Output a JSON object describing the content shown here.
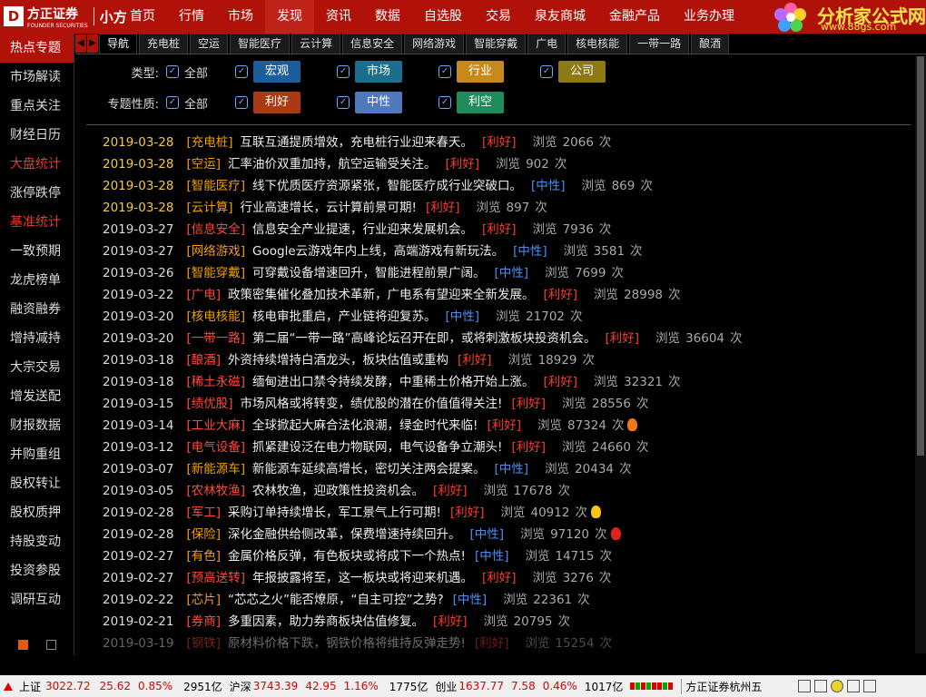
{
  "logo": {
    "brand": "方正证券",
    "brand_sub": "FOUNDER SECURITIES",
    "product": "小方"
  },
  "menu": [
    {
      "label": "首页"
    },
    {
      "label": "行情"
    },
    {
      "label": "市场"
    },
    {
      "label": "发现",
      "active": true
    },
    {
      "label": "资讯"
    },
    {
      "label": "数据"
    },
    {
      "label": "自选股"
    },
    {
      "label": "交易"
    },
    {
      "label": "泉友商城"
    },
    {
      "label": "金融产品"
    },
    {
      "label": "业务办理"
    }
  ],
  "ad": {
    "title": "分析家公式网",
    "url": "www.88gs.com"
  },
  "sidebar": [
    {
      "label": "热点专题",
      "active": true
    },
    {
      "label": "市场解读"
    },
    {
      "label": "重点关注"
    },
    {
      "label": "财经日历"
    },
    {
      "label": "大盘统计",
      "red": true
    },
    {
      "label": "涨停跌停"
    },
    {
      "label": "基准统计",
      "red": true
    },
    {
      "label": "一致预期"
    },
    {
      "label": "龙虎榜单"
    },
    {
      "label": "融资融券"
    },
    {
      "label": "增持减持"
    },
    {
      "label": "大宗交易"
    },
    {
      "label": "增发送配"
    },
    {
      "label": "财报数据"
    },
    {
      "label": "并购重组"
    },
    {
      "label": "股权转让"
    },
    {
      "label": "股权质押"
    },
    {
      "label": "持股变动"
    },
    {
      "label": "投资参股"
    },
    {
      "label": "调研互动"
    }
  ],
  "tabs": [
    {
      "label": "导航",
      "active": true
    },
    {
      "label": "充电桩"
    },
    {
      "label": "空运"
    },
    {
      "label": "智能医疗"
    },
    {
      "label": "云计算"
    },
    {
      "label": "信息安全"
    },
    {
      "label": "网络游戏"
    },
    {
      "label": "智能穿戴"
    },
    {
      "label": "广电"
    },
    {
      "label": "核电核能"
    },
    {
      "label": "一带一路"
    },
    {
      "label": "酿酒"
    }
  ],
  "filters": {
    "type_label": "类型:",
    "nature_label": "专题性质:",
    "all_label": "全部",
    "type_chips": [
      {
        "label": "宏观",
        "color": "#1c5e9c"
      },
      {
        "label": "市场",
        "color": "#1b6f8c"
      },
      {
        "label": "行业",
        "color": "#c8891c"
      },
      {
        "label": "公司",
        "color": "#8e7a14"
      }
    ],
    "nature_chips": [
      {
        "label": "利好",
        "color": "#a83a14"
      },
      {
        "label": "中性",
        "color": "#4f79b8"
      },
      {
        "label": "利空",
        "color": "#1f8c5c"
      }
    ]
  },
  "views_label": "浏览",
  "views_unit": "次",
  "news": [
    {
      "date": "2019-03-28",
      "tag": "[充电桩]",
      "title": "互联互通提质增效，充电桩行业迎来春天。",
      "nature": "[利好]",
      "views": "2066",
      "hl": true
    },
    {
      "date": "2019-03-28",
      "tag": "[空运]",
      "title": "汇率油价双重加持，航空运输受关注。",
      "nature": "[利好]",
      "views": "902",
      "hl": true
    },
    {
      "date": "2019-03-28",
      "tag": "[智能医疗]",
      "title": "线下优质医疗资源紧张，智能医疗成行业突破口。",
      "nature": "[中性]",
      "views": "869",
      "hl": true
    },
    {
      "date": "2019-03-28",
      "tag": "[云计算]",
      "title": "行业高速增长，云计算前景可期!",
      "nature": "[利好]",
      "views": "897",
      "hl": true
    },
    {
      "date": "2019-03-27",
      "tag": "[信息安全]",
      "title": "信息安全产业提速，行业迎来发展机会。",
      "nature": "[利好]",
      "views": "7936"
    },
    {
      "date": "2019-03-27",
      "tag": "[网络游戏]",
      "title": "Google云游戏年内上线，高端游戏有新玩法。",
      "nature": "[中性]",
      "views": "3581"
    },
    {
      "date": "2019-03-26",
      "tag": "[智能穿戴]",
      "title": "可穿戴设备增速回升，智能进程前景广阔。",
      "nature": "[中性]",
      "views": "7699"
    },
    {
      "date": "2019-03-22",
      "tag": "[广电]",
      "title": "政策密集催化叠加技术革新，广电系有望迎来全新发展。",
      "nature": "[利好]",
      "views": "28998"
    },
    {
      "date": "2019-03-20",
      "tag": "[核电核能]",
      "title": "核电审批重启，产业链将迎复苏。",
      "nature": "[中性]",
      "views": "21702"
    },
    {
      "date": "2019-03-20",
      "tag": "[一带一路]",
      "title": "第二届“一带一路”高峰论坛召开在即，或将刺激板块投资机会。",
      "nature": "[利好]",
      "views": "36604"
    },
    {
      "date": "2019-03-18",
      "tag": "[酿酒]",
      "title": "外资持续增持白酒龙头，板块估值或重构",
      "nature": "[利好]",
      "views": "18929"
    },
    {
      "date": "2019-03-18",
      "tag": "[稀土永磁]",
      "title": "缅甸进出口禁令持续发酵，中重稀土价格开始上涨。",
      "nature": "[利好]",
      "views": "32321"
    },
    {
      "date": "2019-03-15",
      "tag": "[绩优股]",
      "title": "市场风格或将转变，绩优股的潜在价值值得关注!",
      "nature": "[利好]",
      "views": "28556"
    },
    {
      "date": "2019-03-14",
      "tag": "[工业大麻]",
      "title": "全球掀起大麻合法化浪潮，绿金时代来临!",
      "nature": "[利好]",
      "views": "87324",
      "icon": "flame-orange"
    },
    {
      "date": "2019-03-12",
      "tag": "[电气设备]",
      "title": "抓紧建设泛在电力物联网，电气设备争立潮头!",
      "nature": "[利好]",
      "views": "24660"
    },
    {
      "date": "2019-03-07",
      "tag": "[新能源车]",
      "title": "新能源车延续高增长，密切关注两会提案。",
      "nature": "[中性]",
      "views": "20434"
    },
    {
      "date": "2019-03-05",
      "tag": "[农林牧渔]",
      "title": "农林牧渔，迎政策性投资机会。",
      "nature": "[利好]",
      "views": "17678"
    },
    {
      "date": "2019-02-28",
      "tag": "[军工]",
      "title": "采购订单持续增长，军工景气上行可期!",
      "nature": "[利好]",
      "views": "40912",
      "icon": "flame-yellow"
    },
    {
      "date": "2019-02-28",
      "tag": "[保险]",
      "title": "深化金融供给侧改革，保费增速持续回升。",
      "nature": "[中性]",
      "views": "97120",
      "icon": "flame-red"
    },
    {
      "date": "2019-02-27",
      "tag": "[有色]",
      "title": "金属价格反弹，有色板块或将成下一个热点!",
      "nature": "[中性]",
      "views": "14715"
    },
    {
      "date": "2019-02-27",
      "tag": "[预高送转]",
      "title": "年报披露将至，这一板块或将迎来机遇。",
      "nature": "[利好]",
      "views": "3276"
    },
    {
      "date": "2019-02-22",
      "tag": "[芯片]",
      "title": "“芯芯之火”能否燎原，“自主可控”之势?",
      "nature": "[中性]",
      "views": "22361"
    },
    {
      "date": "2019-02-21",
      "tag": "[券商]",
      "title": "多重因素，助力券商板块估值修复。",
      "nature": "[利好]",
      "views": "20795"
    },
    {
      "date": "2019-03-19",
      "tag": "[钢铁]",
      "title": "原材料价格下跌，钢铁价格将维持反弹走势!",
      "nature": "[利好]",
      "views": "15254",
      "dim": true
    }
  ],
  "statusbar": {
    "sh": {
      "name": "上证",
      "price": "3022.72",
      "chg": "25.62",
      "pct": "0.85%",
      "amt": "2951亿"
    },
    "sz": {
      "name": "沪深",
      "price": "3743.39",
      "chg": "42.95",
      "pct": "1.16%",
      "amt": "1775亿"
    },
    "cy": {
      "name": "创业",
      "price": "1637.77",
      "chg": "7.58",
      "pct": "0.46%",
      "amt": "1017亿"
    },
    "broker": "方正证券杭州五"
  }
}
